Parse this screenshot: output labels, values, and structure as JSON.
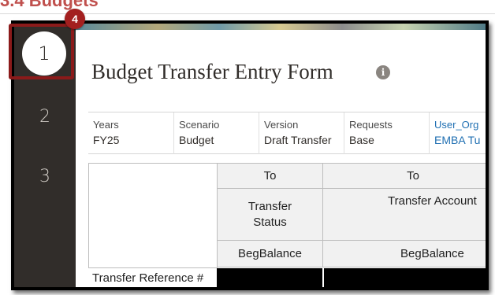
{
  "heading": {
    "text": "3.4 Budgets"
  },
  "sidebar": {
    "items": [
      {
        "label": "1"
      },
      {
        "label": "2"
      },
      {
        "label": "3"
      }
    ]
  },
  "callout": {
    "number": "4"
  },
  "form": {
    "title": "Budget Transfer Entry Form",
    "info_icon": "i"
  },
  "pov": [
    {
      "label": "Years",
      "value": "FY25",
      "link": false
    },
    {
      "label": "Scenario",
      "value": "Budget",
      "link": false
    },
    {
      "label": "Version",
      "value": "Draft Transfer",
      "link": false
    },
    {
      "label": "Requests",
      "value": "Base",
      "link": false
    },
    {
      "label": "User_Org",
      "value": "EMBA Tu",
      "link": true
    }
  ],
  "grid": {
    "col_headers": [
      {
        "direction": "To",
        "name": "Transfer\nStatus",
        "period": "BegBalance"
      },
      {
        "direction": "To",
        "name": "Transfer Account",
        "period": "BegBalance"
      }
    ],
    "row_header": "Transfer Reference #"
  },
  "colors": {
    "accent": "#a31f1f",
    "sidebar": "#312d2a",
    "link": "#1f6fb2"
  }
}
